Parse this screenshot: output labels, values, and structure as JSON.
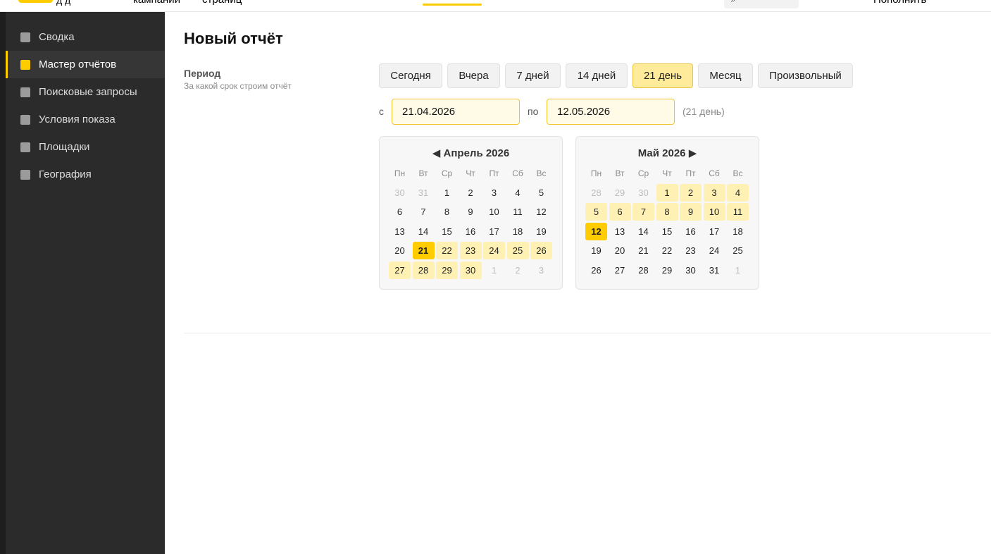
{
  "topbar": {
    "logo_tail": "д д",
    "tabs": [
      "кампаний",
      "страниц"
    ],
    "search_icon": "search-icon",
    "topup_label": "Пополнить"
  },
  "sidebar": {
    "items": [
      {
        "label": "Сводка",
        "active": false
      },
      {
        "label": "Мастер отчётов",
        "active": true
      },
      {
        "label": "Поисковые запросы",
        "active": false
      },
      {
        "label": "Условия показа",
        "active": false
      },
      {
        "label": "Площадки",
        "active": false
      },
      {
        "label": "География",
        "active": false
      }
    ]
  },
  "main": {
    "title": "Новый отчёт",
    "period_label": "Период",
    "period_hint": "За какой срок строим отчёт",
    "presets": [
      {
        "label": "Сегодня",
        "active": false
      },
      {
        "label": "Вчера",
        "active": false
      },
      {
        "label": "7 дней",
        "active": false
      },
      {
        "label": "14 дней",
        "active": false
      },
      {
        "label": "21 день",
        "active": true
      },
      {
        "label": "Месяц",
        "active": false
      },
      {
        "label": "Произвольный",
        "active": false
      }
    ],
    "from_label": "с",
    "to_label": "по",
    "date_from": "21.04.2026",
    "date_to": "12.05.2026",
    "days_count": "(21 день)"
  },
  "calendars": [
    {
      "title": "Апрель 2026",
      "prev_arrow": "◀",
      "next_arrow": "",
      "weekdays": [
        "Пн",
        "Вт",
        "Ср",
        "Чт",
        "Пт",
        "Сб",
        "Вс"
      ],
      "weeks": [
        [
          {
            "d": "30",
            "s": "other"
          },
          {
            "d": "31",
            "s": "other"
          },
          {
            "d": "1",
            "s": ""
          },
          {
            "d": "2",
            "s": ""
          },
          {
            "d": "3",
            "s": ""
          },
          {
            "d": "4",
            "s": ""
          },
          {
            "d": "5",
            "s": ""
          }
        ],
        [
          {
            "d": "6",
            "s": ""
          },
          {
            "d": "7",
            "s": ""
          },
          {
            "d": "8",
            "s": ""
          },
          {
            "d": "9",
            "s": ""
          },
          {
            "d": "10",
            "s": ""
          },
          {
            "d": "11",
            "s": ""
          },
          {
            "d": "12",
            "s": ""
          }
        ],
        [
          {
            "d": "13",
            "s": ""
          },
          {
            "d": "14",
            "s": ""
          },
          {
            "d": "15",
            "s": ""
          },
          {
            "d": "16",
            "s": ""
          },
          {
            "d": "17",
            "s": ""
          },
          {
            "d": "18",
            "s": ""
          },
          {
            "d": "19",
            "s": ""
          }
        ],
        [
          {
            "d": "20",
            "s": ""
          },
          {
            "d": "21",
            "s": "sel"
          },
          {
            "d": "22",
            "s": "inrange"
          },
          {
            "d": "23",
            "s": "inrange"
          },
          {
            "d": "24",
            "s": "inrange"
          },
          {
            "d": "25",
            "s": "inrange"
          },
          {
            "d": "26",
            "s": "inrange"
          }
        ],
        [
          {
            "d": "27",
            "s": "inrange"
          },
          {
            "d": "28",
            "s": "inrange"
          },
          {
            "d": "29",
            "s": "inrange"
          },
          {
            "d": "30",
            "s": "inrange"
          },
          {
            "d": "1",
            "s": "other"
          },
          {
            "d": "2",
            "s": "other"
          },
          {
            "d": "3",
            "s": "other"
          }
        ]
      ]
    },
    {
      "title": "Май 2026",
      "prev_arrow": "",
      "next_arrow": "▶",
      "weekdays": [
        "Пн",
        "Вт",
        "Ср",
        "Чт",
        "Пт",
        "Сб",
        "Вс"
      ],
      "weeks": [
        [
          {
            "d": "28",
            "s": "other"
          },
          {
            "d": "29",
            "s": "other"
          },
          {
            "d": "30",
            "s": "other"
          },
          {
            "d": "1",
            "s": "inrange"
          },
          {
            "d": "2",
            "s": "inrange"
          },
          {
            "d": "3",
            "s": "inrange"
          },
          {
            "d": "4",
            "s": "inrange"
          }
        ],
        [
          {
            "d": "5",
            "s": "inrange"
          },
          {
            "d": "6",
            "s": "inrange"
          },
          {
            "d": "7",
            "s": "inrange"
          },
          {
            "d": "8",
            "s": "inrange"
          },
          {
            "d": "9",
            "s": "inrange"
          },
          {
            "d": "10",
            "s": "inrange"
          },
          {
            "d": "11",
            "s": "inrange"
          }
        ],
        [
          {
            "d": "12",
            "s": "sel"
          },
          {
            "d": "13",
            "s": ""
          },
          {
            "d": "14",
            "s": ""
          },
          {
            "d": "15",
            "s": ""
          },
          {
            "d": "16",
            "s": ""
          },
          {
            "d": "17",
            "s": ""
          },
          {
            "d": "18",
            "s": ""
          }
        ],
        [
          {
            "d": "19",
            "s": ""
          },
          {
            "d": "20",
            "s": ""
          },
          {
            "d": "21",
            "s": ""
          },
          {
            "d": "22",
            "s": ""
          },
          {
            "d": "23",
            "s": ""
          },
          {
            "d": "24",
            "s": ""
          },
          {
            "d": "25",
            "s": ""
          }
        ],
        [
          {
            "d": "26",
            "s": ""
          },
          {
            "d": "27",
            "s": ""
          },
          {
            "d": "28",
            "s": ""
          },
          {
            "d": "29",
            "s": ""
          },
          {
            "d": "30",
            "s": ""
          },
          {
            "d": "31",
            "s": ""
          },
          {
            "d": "1",
            "s": "other"
          }
        ]
      ]
    }
  ],
  "colors": {
    "accent": "#ffcc00",
    "range": "#fff0b3",
    "sidebar_bg": "#2b2b2b",
    "input_bg": "#fffbe6"
  }
}
